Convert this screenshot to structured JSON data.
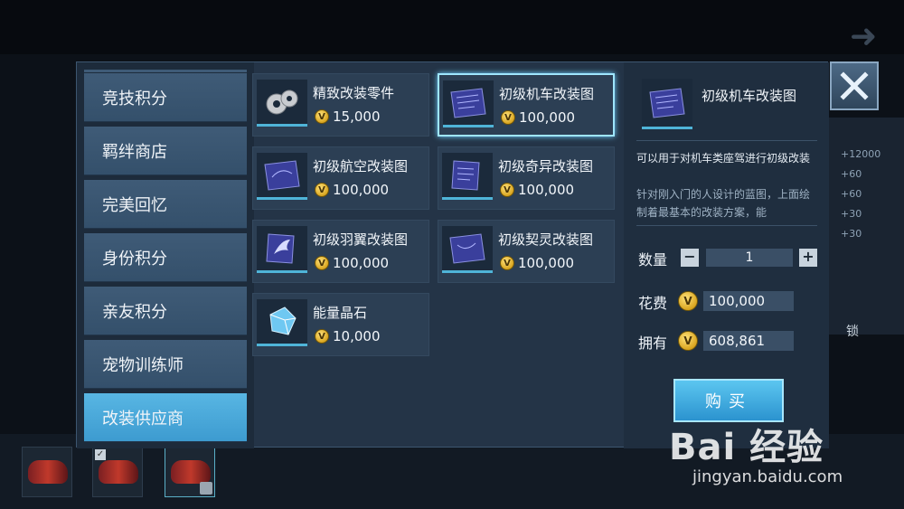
{
  "background": {
    "stats": [
      "+12000",
      "+60",
      "+60",
      "+30",
      "+30"
    ],
    "lock_text": "锁"
  },
  "categories": [
    {
      "label": "竞技积分",
      "active": false
    },
    {
      "label": "羁绊商店",
      "active": false
    },
    {
      "label": "完美回忆",
      "active": false
    },
    {
      "label": "身份积分",
      "active": false
    },
    {
      "label": "亲友积分",
      "active": false
    },
    {
      "label": "宠物训练师",
      "active": false
    },
    {
      "label": "改装供应商",
      "active": true
    }
  ],
  "items": [
    {
      "name": "精致改装零件",
      "price": "15,000",
      "icon": "gear-parts-icon",
      "selected": false
    },
    {
      "name": "初级机车改装图",
      "price": "100,000",
      "icon": "blueprint-icon",
      "selected": true
    },
    {
      "name": "初级航空改装图",
      "price": "100,000",
      "icon": "blueprint-icon",
      "selected": false
    },
    {
      "name": "初级奇异改装图",
      "price": "100,000",
      "icon": "blueprint-icon",
      "selected": false
    },
    {
      "name": "初级羽翼改装图",
      "price": "100,000",
      "icon": "blueprint-wing-icon",
      "selected": false
    },
    {
      "name": "初级契灵改装图",
      "price": "100,000",
      "icon": "blueprint-icon",
      "selected": false
    },
    {
      "name": "能量晶石",
      "price": "10,000",
      "icon": "crystal-icon",
      "selected": false
    }
  ],
  "detail": {
    "title": "初级机车改装图",
    "desc_main": "可以用于对机车类座驾进行初级改装",
    "desc_flavor": "针对刚入门的人设计的蓝图，上面绘制着最基本的改装方案，能",
    "qty_label": "数量",
    "qty_minus": "−",
    "qty_value": "1",
    "qty_plus": "+",
    "cost_label": "花费",
    "cost_value": "100,000",
    "own_label": "拥有",
    "own_value": "608,861",
    "buy_label": "购买"
  },
  "coin_glyph": "V",
  "watermark": {
    "logo": "Bai 经验",
    "url": "jingyan.baidu.com"
  },
  "colors": {
    "accent": "#58b6e3",
    "coin": "#d9a520",
    "selected_border": "#9fe6ff"
  }
}
